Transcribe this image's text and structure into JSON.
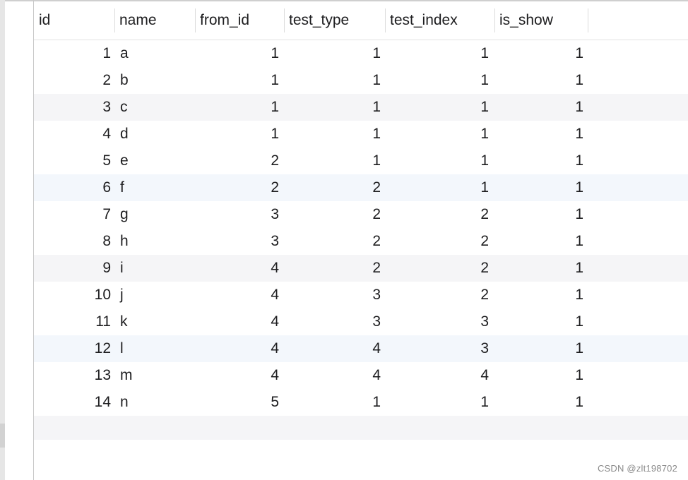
{
  "table": {
    "columns": [
      "id",
      "name",
      "from_id",
      "test_type",
      "test_index",
      "is_show"
    ],
    "rows": [
      {
        "id": "1",
        "name": "a",
        "from_id": "1",
        "test_type": "1",
        "test_index": "1",
        "is_show": "1"
      },
      {
        "id": "2",
        "name": "b",
        "from_id": "1",
        "test_type": "1",
        "test_index": "1",
        "is_show": "1"
      },
      {
        "id": "3",
        "name": "c",
        "from_id": "1",
        "test_type": "1",
        "test_index": "1",
        "is_show": "1"
      },
      {
        "id": "4",
        "name": "d",
        "from_id": "1",
        "test_type": "1",
        "test_index": "1",
        "is_show": "1"
      },
      {
        "id": "5",
        "name": "e",
        "from_id": "2",
        "test_type": "1",
        "test_index": "1",
        "is_show": "1"
      },
      {
        "id": "6",
        "name": "f",
        "from_id": "2",
        "test_type": "2",
        "test_index": "1",
        "is_show": "1"
      },
      {
        "id": "7",
        "name": "g",
        "from_id": "3",
        "test_type": "2",
        "test_index": "2",
        "is_show": "1"
      },
      {
        "id": "8",
        "name": "h",
        "from_id": "3",
        "test_type": "2",
        "test_index": "2",
        "is_show": "1"
      },
      {
        "id": "9",
        "name": "i",
        "from_id": "4",
        "test_type": "2",
        "test_index": "2",
        "is_show": "1"
      },
      {
        "id": "10",
        "name": "j",
        "from_id": "4",
        "test_type": "3",
        "test_index": "2",
        "is_show": "1"
      },
      {
        "id": "11",
        "name": "k",
        "from_id": "4",
        "test_type": "3",
        "test_index": "3",
        "is_show": "1"
      },
      {
        "id": "12",
        "name": "l",
        "from_id": "4",
        "test_type": "4",
        "test_index": "3",
        "is_show": "1"
      },
      {
        "id": "13",
        "name": "m",
        "from_id": "4",
        "test_type": "4",
        "test_index": "4",
        "is_show": "1"
      },
      {
        "id": "14",
        "name": "n",
        "from_id": "5",
        "test_type": "1",
        "test_index": "1",
        "is_show": "1"
      }
    ]
  },
  "watermark": "CSDN @zlt198702",
  "colors": {
    "stripe": "#f5f5f7",
    "selected_tint": "#f3f7fc",
    "gutter": "#e6e6e6",
    "text": "#1d1d1f"
  }
}
